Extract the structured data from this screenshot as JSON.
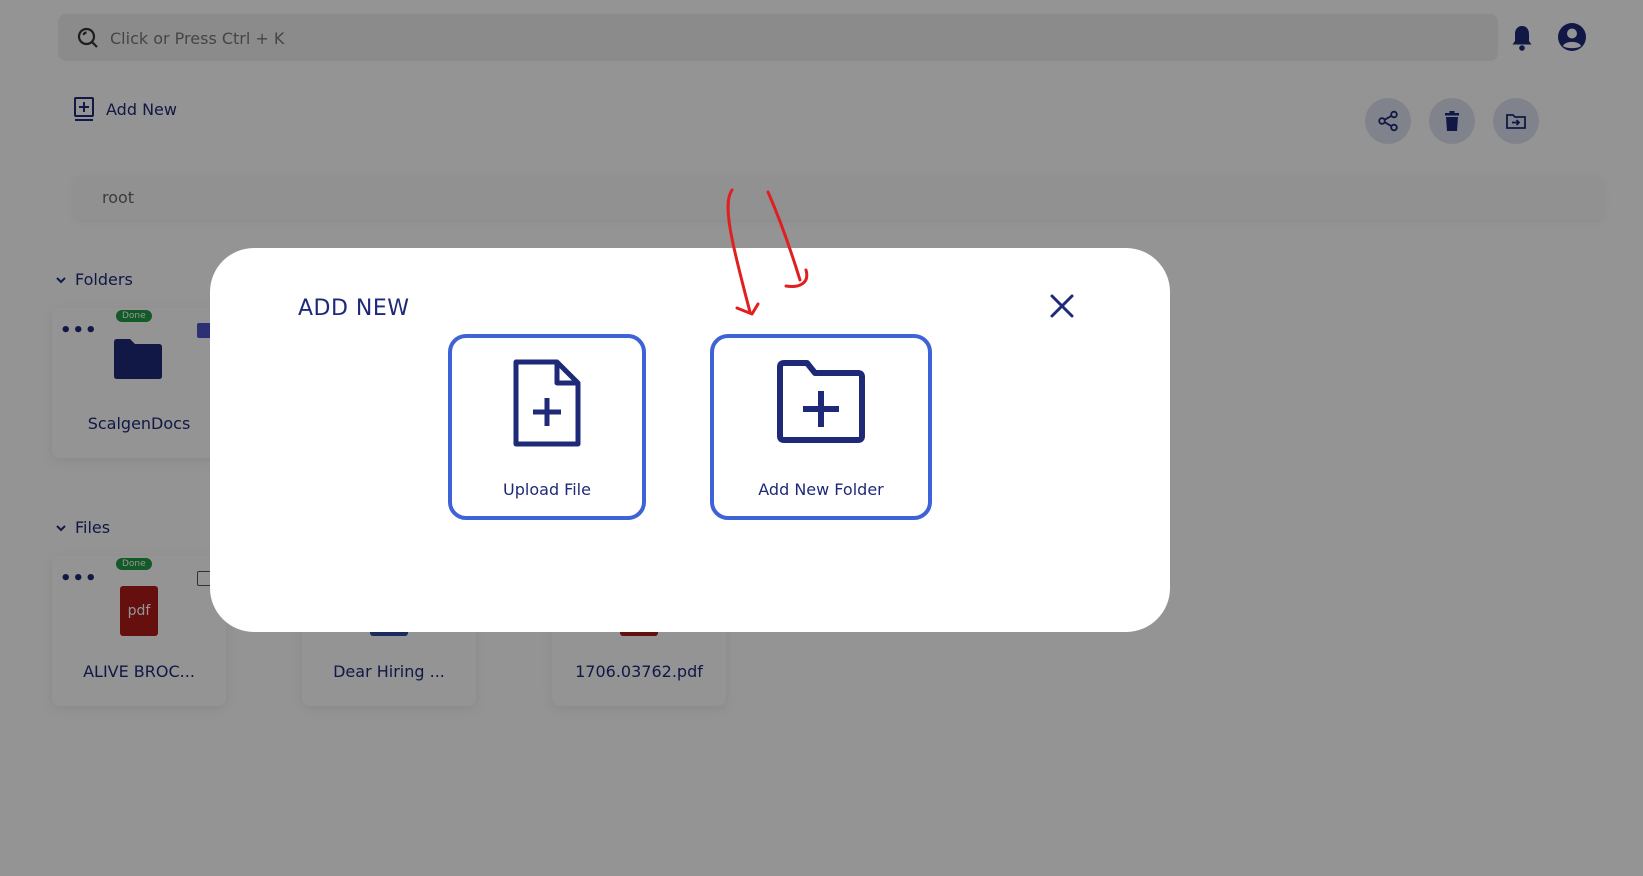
{
  "search": {
    "placeholder": "Click or Press Ctrl + K"
  },
  "toolbar": {
    "add_new_label": "Add New"
  },
  "breadcrumb": {
    "path": "root"
  },
  "sections": {
    "folders": "Folders",
    "files": "Files"
  },
  "folders": [
    {
      "name": "ScalgenDocs",
      "status": "Done"
    }
  ],
  "files": [
    {
      "name": "ALIVE BROC...",
      "status": "Done",
      "type_label": "pdf"
    },
    {
      "name": "Dear Hiring ..."
    },
    {
      "name": "1706.03762.pdf"
    }
  ],
  "modal": {
    "title": "ADD NEW",
    "options": [
      {
        "label": "Upload File",
        "icon": "file-plus-icon"
      },
      {
        "label": "Add New Folder",
        "icon": "folder-plus-icon"
      }
    ]
  },
  "icons": {
    "search": "search-icon",
    "bell": "bell-icon",
    "user": "user-circle-icon",
    "share": "share-icon",
    "trash": "trash-icon",
    "move": "folder-move-icon",
    "close": "close-icon"
  },
  "colors": {
    "primary": "#1e2a78",
    "accent_border": "#3d63d6",
    "done_badge": "#1f9d48",
    "pdf_red": "#b01a1a",
    "annotation": "#e02020"
  }
}
